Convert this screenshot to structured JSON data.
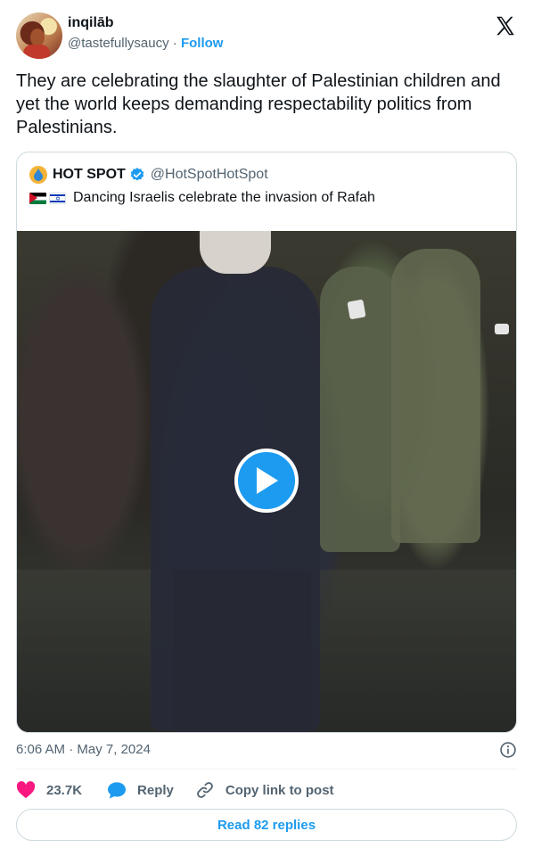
{
  "author": {
    "display_name": "inqilāb",
    "handle": "@tastefullysaucy",
    "separator": " · ",
    "follow_label": "Follow",
    "avatar_icon": "user-avatar-photo"
  },
  "tweet": {
    "text": "They are celebrating the slaughter of Palestinian children and yet the world keeps demanding respectability politics from Palestinians."
  },
  "quoted_tweet": {
    "display_name": "HOT SPOT",
    "handle": "@HotSpotHotSpot",
    "verified": true,
    "flags": [
      "palestine-flag-icon",
      "israel-flag-icon"
    ],
    "text": "Dancing Israelis celebrate the invasion of Rafah",
    "media": {
      "type": "video",
      "play_icon": "play-icon"
    }
  },
  "meta": {
    "time": "6:06 AM",
    "separator": " · ",
    "date": "May 7, 2024",
    "info_icon": "info-icon"
  },
  "actions": {
    "likes_count": "23.7K",
    "reply_label": "Reply",
    "copy_link_label": "Copy link to post"
  },
  "read_replies_label": "Read 82 replies",
  "colors": {
    "accent": "#1d9bf0",
    "heart": "#f91880",
    "text": "#0f1419",
    "muted": "#536471",
    "border": "#cfd9de"
  }
}
